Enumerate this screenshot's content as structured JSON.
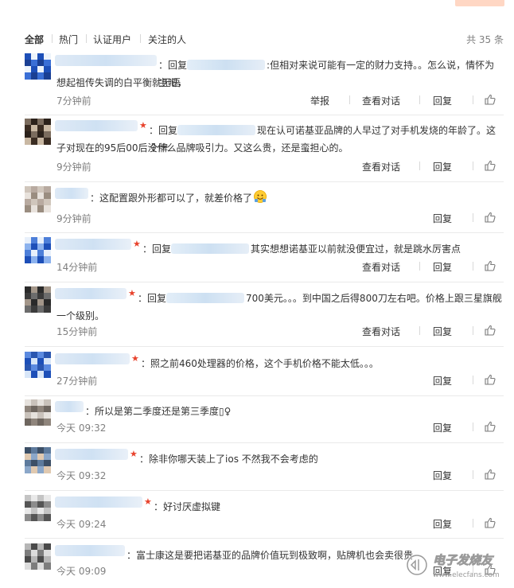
{
  "tabs": [
    "全部",
    "热门",
    "认证用户",
    "关注的人"
  ],
  "total": "共 35 条",
  "labels": {
    "reply": "回复",
    "report": "举报",
    "view_conversation": "查看对话",
    "reply_prefix": "回复"
  },
  "colors": {
    "vip_star": "#e8422c",
    "blur_blue": "#cfe5f8",
    "text": "#333333",
    "muted": "#808080"
  },
  "comments": [
    {
      "has_reply_to": true,
      "text_a": ":但相对来说可能有一定的财力支持。。怎么说，情怀为主吧，",
      "text_b": "想起祖传失调的白平衡就无语",
      "time": "7分钟前",
      "report": true,
      "conversation": true
    },
    {
      "has_reply_to": true,
      "vip": true,
      "text_a": "现在认可诺基亚品牌的人早过了对手机发烧的年龄了。这个牌",
      "text_b": "子对现在的95后00后没什么品牌吸引力。又这么贵，还是蛮担心的。",
      "time": "9分钟前",
      "report": false,
      "conversation": true
    },
    {
      "has_reply_to": false,
      "text_a": "这配置跟外形都可以了，就差价格了",
      "emoji": "smiley-emoji",
      "time": "9分钟前",
      "report": false,
      "conversation": false
    },
    {
      "has_reply_to": true,
      "vip": true,
      "text_a": "其实想想诺基亚以前就没便宜过，就是跳水厉害点",
      "time": "14分钟前",
      "report": false,
      "conversation": true
    },
    {
      "has_reply_to": true,
      "vip": true,
      "text_a": "700美元。。。到中国之后得800刀左右吧。价格上跟三星旗舰",
      "text_b": "一个级别。",
      "time": "15分钟前",
      "report": false,
      "conversation": true
    },
    {
      "has_reply_to": false,
      "vip": true,
      "text_a": "照之前460处理器的价格，这个手机价格不能太低。。。",
      "time": "27分钟前",
      "report": false,
      "conversation": false
    },
    {
      "has_reply_to": false,
      "text_a": "所以是第二季度还是第三季度▯♀",
      "time": "今天 09:32",
      "report": false,
      "conversation": false
    },
    {
      "has_reply_to": false,
      "vip": true,
      "text_a": "除非你哪天装上了ios 不然我不会考虑的",
      "time": "今天 09:32",
      "report": false,
      "conversation": false
    },
    {
      "has_reply_to": false,
      "vip": true,
      "text_a": "好讨厌虚拟键",
      "time": "今天 09:24",
      "report": false,
      "conversation": false
    },
    {
      "has_reply_to": false,
      "text_a": "富士康这是要把诺基亚的品牌价值玩到极致啊，贴牌机也会卖很贵",
      "time": "今天 09:09",
      "report": false,
      "conversation": false
    }
  ],
  "watermark": {
    "title": "电子发烧友",
    "url": "www.elecfans.com"
  }
}
